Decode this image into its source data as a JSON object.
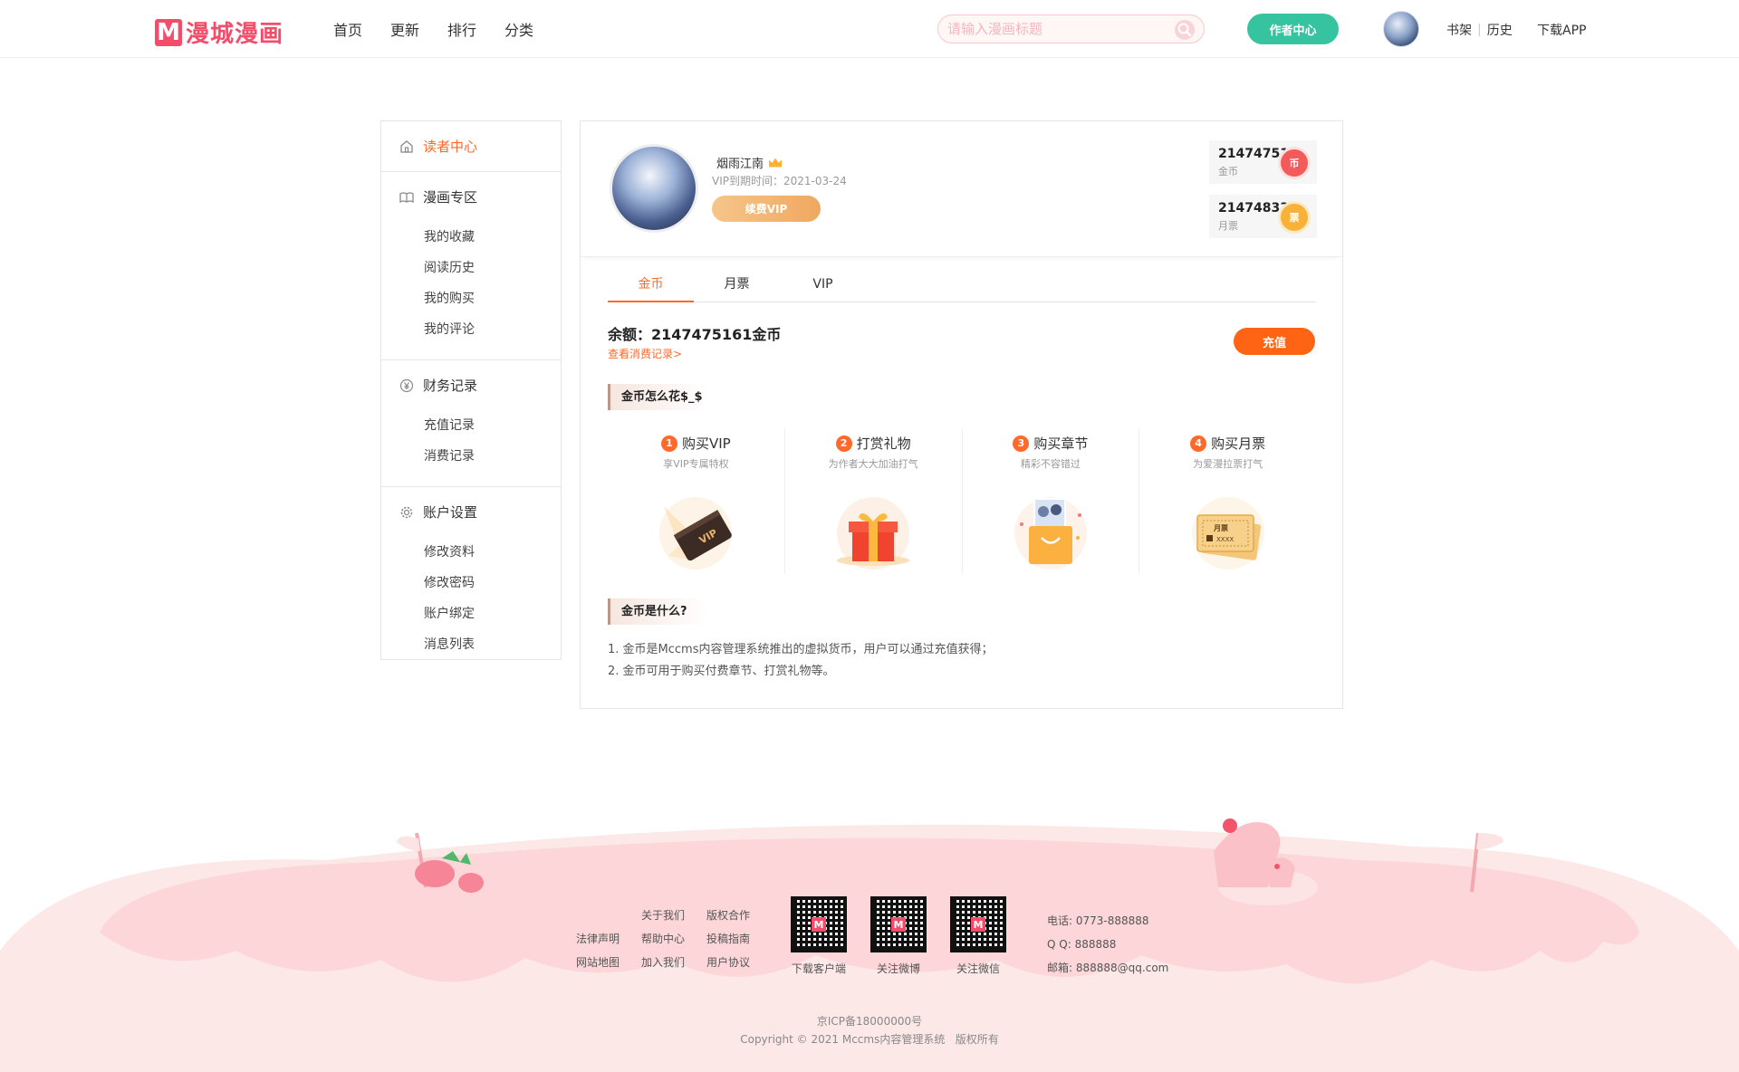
{
  "header": {
    "logo_letter": "M",
    "logo_text": "漫城漫画",
    "nav": [
      "首页",
      "更新",
      "排行",
      "分类"
    ],
    "search_placeholder": "请输入漫画标题",
    "author_button": "作者中心",
    "shelf": "书架",
    "history": "历史",
    "download": "下载APP"
  },
  "sidebar": {
    "groups": [
      {
        "title": "读者中心",
        "icon": "home-icon",
        "items": []
      },
      {
        "title": "漫画专区",
        "icon": "book-icon",
        "items": [
          "我的收藏",
          "阅读历史",
          "我的购买",
          "我的评论"
        ]
      },
      {
        "title": "财务记录",
        "icon": "yen-icon",
        "items": [
          "充值记录",
          "消费记录"
        ]
      },
      {
        "title": "账户设置",
        "icon": "gear-icon",
        "items": [
          "修改资料",
          "修改密码",
          "账户绑定",
          "消息列表"
        ]
      }
    ]
  },
  "profile": {
    "username": "烟雨江南",
    "vip_expiry": "VIP到期时间：2021-03-24",
    "renew_button": "续费VIP",
    "coins_value": "2147475161",
    "coins_label": "金币",
    "coins_badge": "币",
    "tickets_value": "2147483380",
    "tickets_label": "月票",
    "tickets_badge": "票"
  },
  "tabs": [
    "金币",
    "月票",
    "VIP"
  ],
  "balance": {
    "text": "余额：2147475161金币",
    "record_link": "查看消费记录>",
    "recharge_button": "充值"
  },
  "how_to_spend": {
    "title": "金币怎么花$_$",
    "ways": [
      {
        "num": "1",
        "title": "购买VIP",
        "desc": "享VIP专属特权"
      },
      {
        "num": "2",
        "title": "打赏礼物",
        "desc": "为作者大大加油打气"
      },
      {
        "num": "3",
        "title": "购买章节",
        "desc": "精彩不容错过"
      },
      {
        "num": "4",
        "title": "购买月票",
        "desc": "为爱漫拉票打气"
      }
    ]
  },
  "faq": {
    "title": "金币是什么?",
    "lines": [
      "1. 金币是Mccms内容管理系统推出的虚拟货币，用户可以通过充值获得；",
      "2. 金币可用于购买付费章节、打赏礼物等。"
    ]
  },
  "footer": {
    "links": [
      "关于我们",
      "版权合作",
      "法律声明",
      "帮助中心",
      "投稿指南",
      "网站地图",
      "加入我们",
      "用户协议"
    ],
    "qr_labels": [
      "下载客户端",
      "关注微博",
      "关注微信"
    ],
    "qr_mark": "M",
    "phone": "电话: 0773-888888",
    "qq": "Q Q: 888888",
    "email": "邮箱: 888888@qq.com",
    "icp": "京ICP备18000000号",
    "copyright": "Copyright © 2021 Mccms内容管理系统   版权所有"
  },
  "ticket_art_text": "月票",
  "ticket_art_code": "XXXX",
  "vip_art_text": "VIP",
  "colors": {
    "accent": "#ff6a2b",
    "brand": "#f44d6b",
    "author_btn": "#35c3a0"
  }
}
